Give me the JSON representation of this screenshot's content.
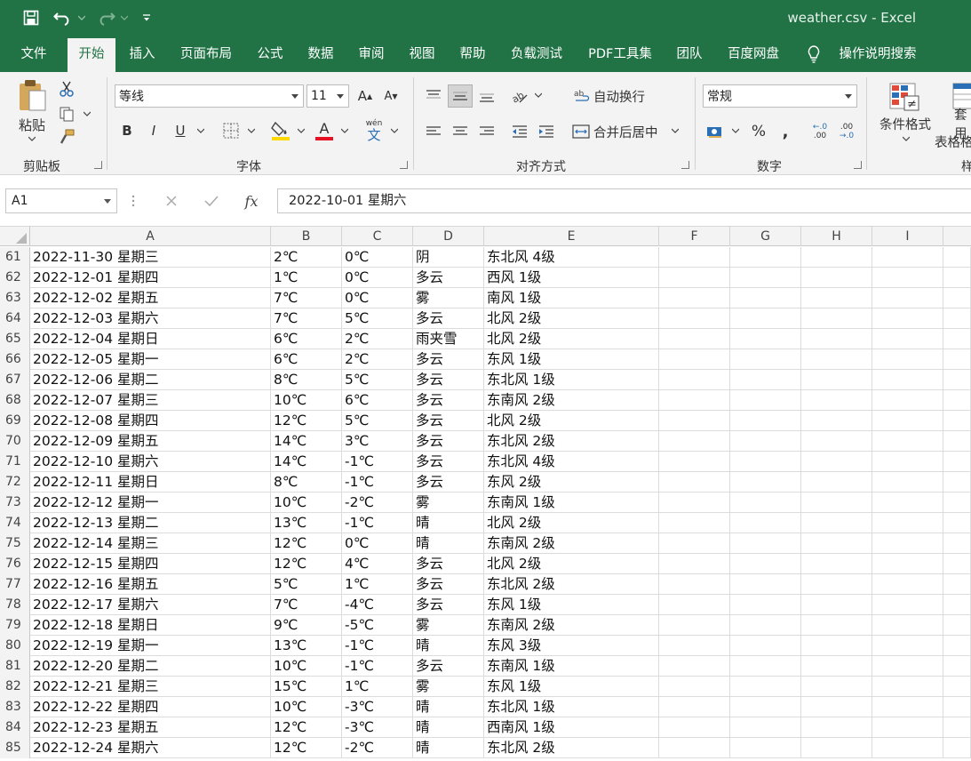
{
  "window": {
    "title": "weather.csv  -  Excel"
  },
  "tabs": [
    "文件",
    "开始",
    "插入",
    "页面布局",
    "公式",
    "数据",
    "审阅",
    "视图",
    "帮助",
    "负载测试",
    "PDF工具集",
    "团队",
    "百度网盘"
  ],
  "tell_me": "操作说明搜索",
  "ribbon": {
    "clipboard": {
      "paste": "粘贴",
      "group": "剪贴板"
    },
    "font": {
      "name": "等线",
      "size": "11",
      "bold": "B",
      "italic": "I",
      "underline": "U",
      "phonetic_top": "wén",
      "phonetic_bottom": "文",
      "grow": "A",
      "shrink": "A",
      "fill_label": "A",
      "group": "字体"
    },
    "alignment": {
      "wrap": "自动换行",
      "merge": "合并后居中",
      "group": "对齐方式"
    },
    "number": {
      "format": "常规",
      "percent": "%",
      "comma": ",",
      "inc": ".00",
      "dec": ".00",
      "group": "数字"
    },
    "styles": {
      "conditional": "条件格式",
      "table_line1": "套用",
      "table_line2": "表格格式",
      "group": "样"
    }
  },
  "formula_bar": {
    "name_box": "A1",
    "formula": "2022-10-01 星期六",
    "fx": "fx"
  },
  "columns": [
    "A",
    "B",
    "C",
    "D",
    "E",
    "F",
    "G",
    "H",
    "I"
  ],
  "rows": [
    {
      "n": "61",
      "a": "2022-11-30 星期三",
      "b": "2℃",
      "c": "0℃",
      "d": "阴",
      "e": "东北风 4级"
    },
    {
      "n": "62",
      "a": "2022-12-01 星期四",
      "b": "1℃",
      "c": "0℃",
      "d": "多云",
      "e": "西风 1级"
    },
    {
      "n": "63",
      "a": "2022-12-02 星期五",
      "b": "7℃",
      "c": "0℃",
      "d": "雾",
      "e": "南风 1级"
    },
    {
      "n": "64",
      "a": "2022-12-03 星期六",
      "b": "7℃",
      "c": "5℃",
      "d": "多云",
      "e": "北风 2级"
    },
    {
      "n": "65",
      "a": "2022-12-04 星期日",
      "b": "6℃",
      "c": "2℃",
      "d": "雨夹雪",
      "e": "北风 2级"
    },
    {
      "n": "66",
      "a": "2022-12-05 星期一",
      "b": "6℃",
      "c": "2℃",
      "d": "多云",
      "e": "东风 1级"
    },
    {
      "n": "67",
      "a": "2022-12-06 星期二",
      "b": "8℃",
      "c": "5℃",
      "d": "多云",
      "e": "东北风 1级"
    },
    {
      "n": "68",
      "a": "2022-12-07 星期三",
      "b": "10℃",
      "c": "6℃",
      "d": "多云",
      "e": "东南风 2级"
    },
    {
      "n": "69",
      "a": "2022-12-08 星期四",
      "b": "12℃",
      "c": "5℃",
      "d": "多云",
      "e": "北风 2级"
    },
    {
      "n": "70",
      "a": "2022-12-09 星期五",
      "b": "14℃",
      "c": "3℃",
      "d": "多云",
      "e": "东北风 2级"
    },
    {
      "n": "71",
      "a": "2022-12-10 星期六",
      "b": "14℃",
      "c": "-1℃",
      "d": "多云",
      "e": "东北风 4级"
    },
    {
      "n": "72",
      "a": "2022-12-11 星期日",
      "b": "8℃",
      "c": "-1℃",
      "d": "多云",
      "e": "东风 2级"
    },
    {
      "n": "73",
      "a": "2022-12-12 星期一",
      "b": "10℃",
      "c": "-2℃",
      "d": "雾",
      "e": "东南风 1级"
    },
    {
      "n": "74",
      "a": "2022-12-13 星期二",
      "b": "13℃",
      "c": "-1℃",
      "d": "晴",
      "e": "北风 2级"
    },
    {
      "n": "75",
      "a": "2022-12-14 星期三",
      "b": "12℃",
      "c": "0℃",
      "d": "晴",
      "e": "东南风 2级"
    },
    {
      "n": "76",
      "a": "2022-12-15 星期四",
      "b": "12℃",
      "c": "4℃",
      "d": "多云",
      "e": "北风 2级"
    },
    {
      "n": "77",
      "a": "2022-12-16 星期五",
      "b": "5℃",
      "c": "1℃",
      "d": "多云",
      "e": "东北风 2级"
    },
    {
      "n": "78",
      "a": "2022-12-17 星期六",
      "b": "7℃",
      "c": "-4℃",
      "d": "多云",
      "e": "东风 1级"
    },
    {
      "n": "79",
      "a": "2022-12-18 星期日",
      "b": "9℃",
      "c": "-5℃",
      "d": "雾",
      "e": "东南风 2级"
    },
    {
      "n": "80",
      "a": "2022-12-19 星期一",
      "b": "13℃",
      "c": "-1℃",
      "d": "晴",
      "e": "东风 3级"
    },
    {
      "n": "81",
      "a": "2022-12-20 星期二",
      "b": "10℃",
      "c": "-1℃",
      "d": "多云",
      "e": "东南风 1级"
    },
    {
      "n": "82",
      "a": "2022-12-21 星期三",
      "b": "15℃",
      "c": "1℃",
      "d": "雾",
      "e": "东风 1级"
    },
    {
      "n": "83",
      "a": "2022-12-22 星期四",
      "b": "10℃",
      "c": "-3℃",
      "d": "晴",
      "e": "东北风 1级"
    },
    {
      "n": "84",
      "a": "2022-12-23 星期五",
      "b": "12℃",
      "c": "-3℃",
      "d": "晴",
      "e": "西南风 1级"
    },
    {
      "n": "85",
      "a": "2022-12-24 星期六",
      "b": "12℃",
      "c": "-2℃",
      "d": "晴",
      "e": "东北风 2级"
    }
  ],
  "colors": {
    "excel_green": "#217346",
    "ribbon_bg": "#f3f3f3"
  }
}
